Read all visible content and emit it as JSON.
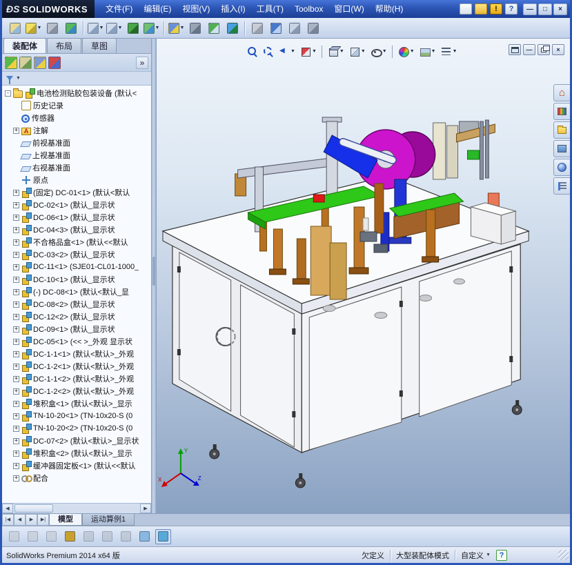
{
  "titlebar": {
    "logo_ds": "ÐS",
    "logo_text": "SOLIDWORKS",
    "menus": [
      "文件(F)",
      "编辑(E)",
      "视图(V)",
      "插入(I)",
      "工具(T)",
      "Toolbox",
      "窗口(W)",
      "帮助(H)"
    ],
    "quick_icons": [
      "new-document",
      "open-document",
      "security-alert",
      "help"
    ],
    "window_controls": [
      {
        "name": "window-minimize-button",
        "glyph": "—"
      },
      {
        "name": "window-maximize-button",
        "glyph": "□"
      },
      {
        "name": "window-close-button",
        "glyph": "×"
      }
    ]
  },
  "main_toolbar": [
    {
      "name": "edit-component",
      "c1": "#e8d890",
      "c2": "#90b8e0"
    },
    {
      "name": "insert-component",
      "c1": "#f0e060",
      "c2": "#c0a830",
      "dd": true
    },
    {
      "name": "attachment",
      "c1": "#b8c0cc",
      "c2": "#8890a0"
    },
    {
      "name": "compare-documents",
      "c1": "#58b858",
      "c2": "#3888c8"
    },
    {
      "name": "edit-window",
      "c1": "#d0dcec",
      "c2": "#88a0c0",
      "dd": true,
      "sep": true
    },
    {
      "name": "new-window",
      "c1": "#d0dcec",
      "c2": "#88a0c0",
      "dd": true
    },
    {
      "name": "selection-filter-toggle",
      "c1": "#48a848",
      "c2": "#286828"
    },
    {
      "name": "filter-window",
      "c1": "#70c070",
      "c2": "#4090d0",
      "dd": true
    },
    {
      "name": "edit-appearance",
      "c1": "#6890d8",
      "c2": "#e8d040",
      "dd": true,
      "sep": true
    },
    {
      "name": "move-rotate-component",
      "c1": "#98a4b4",
      "c2": "#687488"
    },
    {
      "name": "hide-show-components",
      "c1": "#50b050",
      "c2": "#d0e0f0"
    },
    {
      "name": "isolate",
      "c1": "#48a0e0",
      "c2": "#208040"
    },
    {
      "name": "close-document",
      "c1": "#c8ccd4",
      "c2": "#98a0ac",
      "sep": true
    },
    {
      "name": "measure",
      "c1": "#4878c8",
      "c2": "#b8d0f0"
    },
    {
      "name": "mass-properties",
      "c1": "#c8d4e4",
      "c2": "#8898b0"
    },
    {
      "name": "section-properties",
      "c1": "#a8b4c4",
      "c2": "#788498"
    }
  ],
  "command_tabs": [
    {
      "label": "装配体",
      "active": true
    },
    {
      "label": "布局",
      "active": false
    },
    {
      "label": "草图",
      "active": false
    }
  ],
  "panel": {
    "header_icons": [
      {
        "name": "featuremanager-tree-tab",
        "c1": "#58b848",
        "c2": "#f0d040"
      },
      {
        "name": "propertymanager-tab",
        "c1": "#d8cfa0",
        "c2": "#6a9a50"
      },
      {
        "name": "configurationmanager-tab",
        "c1": "#8098d0",
        "c2": "#e8d040"
      },
      {
        "name": "displaymanager-tab",
        "c1": "#d04848",
        "c2": "#4868d0"
      }
    ],
    "expand_glyph": "»",
    "filter_caret": "▼"
  },
  "feature_tree": {
    "root": {
      "label": "电池检测贴胶包装设备 (默认<",
      "expand": "-"
    },
    "items": [
      {
        "icon": "history",
        "label": "历史记录",
        "exp": ""
      },
      {
        "icon": "sensor",
        "label": "传感器",
        "exp": ""
      },
      {
        "icon": "annotation",
        "label": "注解",
        "exp": "+"
      },
      {
        "icon": "plane",
        "label": "前视基准面",
        "exp": ""
      },
      {
        "icon": "plane",
        "label": "上视基准面",
        "exp": ""
      },
      {
        "icon": "plane",
        "label": "右视基准面",
        "exp": ""
      },
      {
        "icon": "origin",
        "label": "原点",
        "exp": ""
      },
      {
        "icon": "component",
        "label": "(固定) DC-01<1> (默认<默认",
        "exp": "+"
      },
      {
        "icon": "component",
        "label": "DC-02<1> (默认_显示状",
        "exp": "+"
      },
      {
        "icon": "component",
        "label": "DC-06<1> (默认_显示状",
        "exp": "+"
      },
      {
        "icon": "component",
        "label": "DC-04<3> (默认_显示状",
        "exp": "+"
      },
      {
        "icon": "component",
        "label": "不合格品盒<1> (默认<<默认",
        "exp": "+"
      },
      {
        "icon": "component",
        "label": "DC-03<2> (默认_显示状",
        "exp": "+"
      },
      {
        "icon": "component",
        "label": "DC-11<1> (SJE01-CL01-1000_",
        "exp": "+"
      },
      {
        "icon": "component",
        "label": "DC-10<1> (默认_显示状",
        "exp": "+"
      },
      {
        "icon": "component",
        "label": "(-) DC-08<1> (默认<默认_显",
        "exp": "+"
      },
      {
        "icon": "component",
        "label": "DC-08<2> (默认_显示状",
        "exp": "+"
      },
      {
        "icon": "component",
        "label": "DC-12<2> (默认_显示状",
        "exp": "+"
      },
      {
        "icon": "component",
        "label": "DC-09<1> (默认_显示状",
        "exp": "+"
      },
      {
        "icon": "component",
        "label": "DC-05<1> (<< >_外观 显示状",
        "exp": "+"
      },
      {
        "icon": "component",
        "label": "DC-1-1<1> (默认<默认>_外观",
        "exp": "+"
      },
      {
        "icon": "component",
        "label": "DC-1-2<1> (默认<默认>_外观",
        "exp": "+"
      },
      {
        "icon": "component",
        "label": "DC-1-1<2> (默认<默认>_外观",
        "exp": "+"
      },
      {
        "icon": "component",
        "label": "DC-1-2<2> (默认<默认>_外观",
        "exp": "+"
      },
      {
        "icon": "component",
        "label": "堆积盒<1> (默认<默认>_显示",
        "exp": "+"
      },
      {
        "icon": "component",
        "label": "TN-10-20<1> (TN-10x20-S (0",
        "exp": "+"
      },
      {
        "icon": "component",
        "label": "TN-10-20<2> (TN-10x20-S (0",
        "exp": "+"
      },
      {
        "icon": "component",
        "label": "DC-07<2> (默认<默认>_显示状",
        "exp": "+"
      },
      {
        "icon": "component",
        "label": "堆积盒<2> (默认<默认>_显示",
        "exp": "+"
      },
      {
        "icon": "component",
        "label": "缓冲器固定板<1> (默认<<默认",
        "exp": "+"
      },
      {
        "icon": "mates",
        "label": "配合",
        "exp": "+"
      }
    ]
  },
  "hud": [
    {
      "name": "zoom-to-fit",
      "g": "zoomfit"
    },
    {
      "name": "zoom-to-area",
      "g": "zoomarea"
    },
    {
      "name": "previous-view",
      "g": "prev",
      "dd": true
    },
    {
      "name": "section-view",
      "g": "section",
      "dd": true
    },
    {
      "name": "view-orientation",
      "g": "cube",
      "dd": true,
      "sep": true
    },
    {
      "name": "display-style",
      "g": "style",
      "dd": true
    },
    {
      "name": "hide-show-items",
      "g": "eye",
      "dd": true
    },
    {
      "name": "edit-appearance",
      "g": "wheel",
      "dd": true,
      "sep": true
    },
    {
      "name": "apply-scene",
      "g": "scene",
      "dd": true
    },
    {
      "name": "view-settings",
      "g": "settings",
      "dd": true
    }
  ],
  "doc_controls": [
    {
      "name": "document-window-menu",
      "type": "win"
    },
    {
      "name": "document-minimize",
      "type": "min",
      "glyph": "—"
    },
    {
      "name": "document-restore",
      "type": "res"
    },
    {
      "name": "document-close",
      "type": "close",
      "glyph": "×"
    }
  ],
  "task_pane": [
    {
      "name": "solidworks-resources",
      "g": "home"
    },
    {
      "name": "design-library",
      "g": "library"
    },
    {
      "name": "file-explorer",
      "g": "folder"
    },
    {
      "name": "view-palette",
      "g": "palette"
    },
    {
      "name": "appearances-scenes",
      "g": "sphere"
    },
    {
      "name": "custom-properties",
      "g": "props"
    }
  ],
  "model_tabs": {
    "nav": [
      "|◀",
      "◀",
      "▶",
      "▶|"
    ],
    "tabs": [
      {
        "label": "模型",
        "active": true
      },
      {
        "label": "运动算例1",
        "active": false
      }
    ]
  },
  "bottom_toolbar": [
    {
      "name": "magnifying-glass",
      "c1": "#c0c6ce",
      "disabled": true
    },
    {
      "name": "previous-view-bottom",
      "c1": "#c0c6ce",
      "disabled": true
    },
    {
      "name": "next-view-bottom",
      "c1": "#c0c6ce",
      "disabled": true
    },
    {
      "name": "edit-selection-filter",
      "c1": "#c8a030"
    },
    {
      "name": "filter-vertices",
      "c1": "#b0b8c4",
      "disabled": true
    },
    {
      "name": "filter-edges",
      "c1": "#b0b8c4",
      "disabled": true
    },
    {
      "name": "filter-faces",
      "c1": "#b0b8c4",
      "disabled": true
    },
    {
      "name": "filter-surface-bodies",
      "c1": "#88b8e0"
    },
    {
      "name": "filter-graphics-bodies",
      "c1": "#58a8d8",
      "pressed": true
    }
  ],
  "statusbar": {
    "product": "SolidWorks Premium 2014 x64 版",
    "definition_state": "欠定义",
    "mode": "大型装配体模式",
    "custom": "自定义",
    "custom_caret": "▼",
    "help_glyph": "?"
  }
}
